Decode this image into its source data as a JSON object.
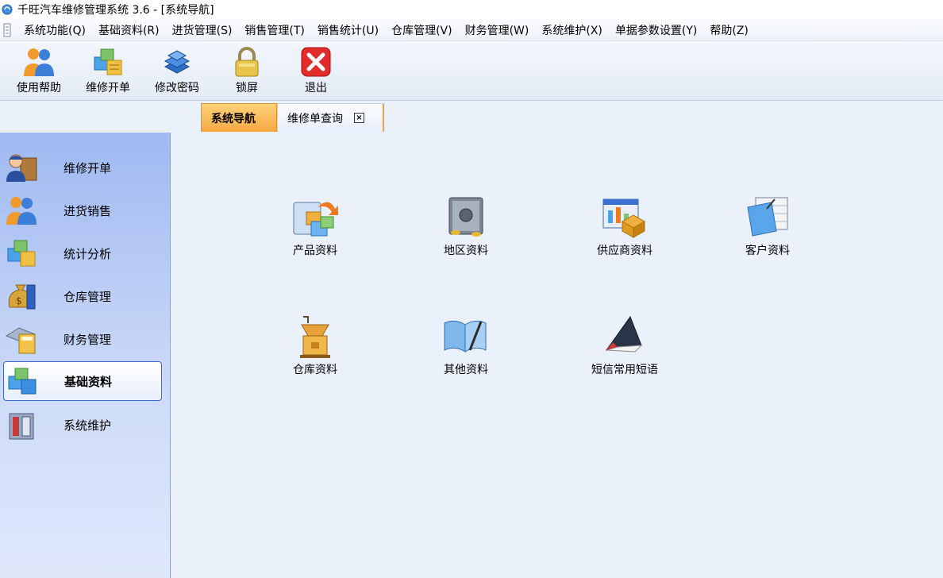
{
  "window": {
    "title": "千旺汽车维修管理系统 3.6 - [系统导航]"
  },
  "menu": [
    {
      "label": "系统功能(Q)"
    },
    {
      "label": "基础资料(R)"
    },
    {
      "label": "进货管理(S)"
    },
    {
      "label": "销售管理(T)"
    },
    {
      "label": "销售统计(U)"
    },
    {
      "label": "仓库管理(V)"
    },
    {
      "label": "财务管理(W)"
    },
    {
      "label": "系统维护(X)"
    },
    {
      "label": "单据参数设置(Y)"
    },
    {
      "label": "帮助(Z)"
    }
  ],
  "toolbar": [
    {
      "label": "使用帮助",
      "icon": "users-icon"
    },
    {
      "label": "维修开单",
      "icon": "boxes-icon"
    },
    {
      "label": "修改密码",
      "icon": "stack-icon"
    },
    {
      "label": "锁屏",
      "icon": "lock-icon"
    },
    {
      "label": "退出",
      "icon": "exit-icon"
    }
  ],
  "tabs": [
    {
      "label": "系统导航",
      "active": true
    },
    {
      "label": "维修单查询",
      "active": false,
      "close": "×"
    }
  ],
  "sidebar": [
    {
      "label": "维修开单",
      "icon": "repair-icon"
    },
    {
      "label": "进货销售",
      "icon": "users-icon"
    },
    {
      "label": "统计分析",
      "icon": "boxes-icon"
    },
    {
      "label": "仓库管理",
      "icon": "money-bag-icon"
    },
    {
      "label": "财务管理",
      "icon": "calculator-icon"
    },
    {
      "label": "基础资料",
      "icon": "boxes-icon",
      "active": true
    },
    {
      "label": "系统维护",
      "icon": "tools-icon"
    }
  ],
  "nav_items": [
    {
      "label": "产品资料",
      "icon": "product-icon"
    },
    {
      "label": "地区资料",
      "icon": "safe-icon"
    },
    {
      "label": "供应商资料",
      "icon": "supplier-icon"
    },
    {
      "label": "客户资料",
      "icon": "customer-icon"
    },
    {
      "label": "仓库资料",
      "icon": "warehouse-icon"
    },
    {
      "label": "其他资料",
      "icon": "book-icon"
    },
    {
      "label": "短信常用短语",
      "icon": "sms-icon"
    }
  ],
  "colors": {
    "accent_tab": "#f5a843",
    "sidebar_active_border": "#3b66d6",
    "background": "#eaf1fb"
  }
}
